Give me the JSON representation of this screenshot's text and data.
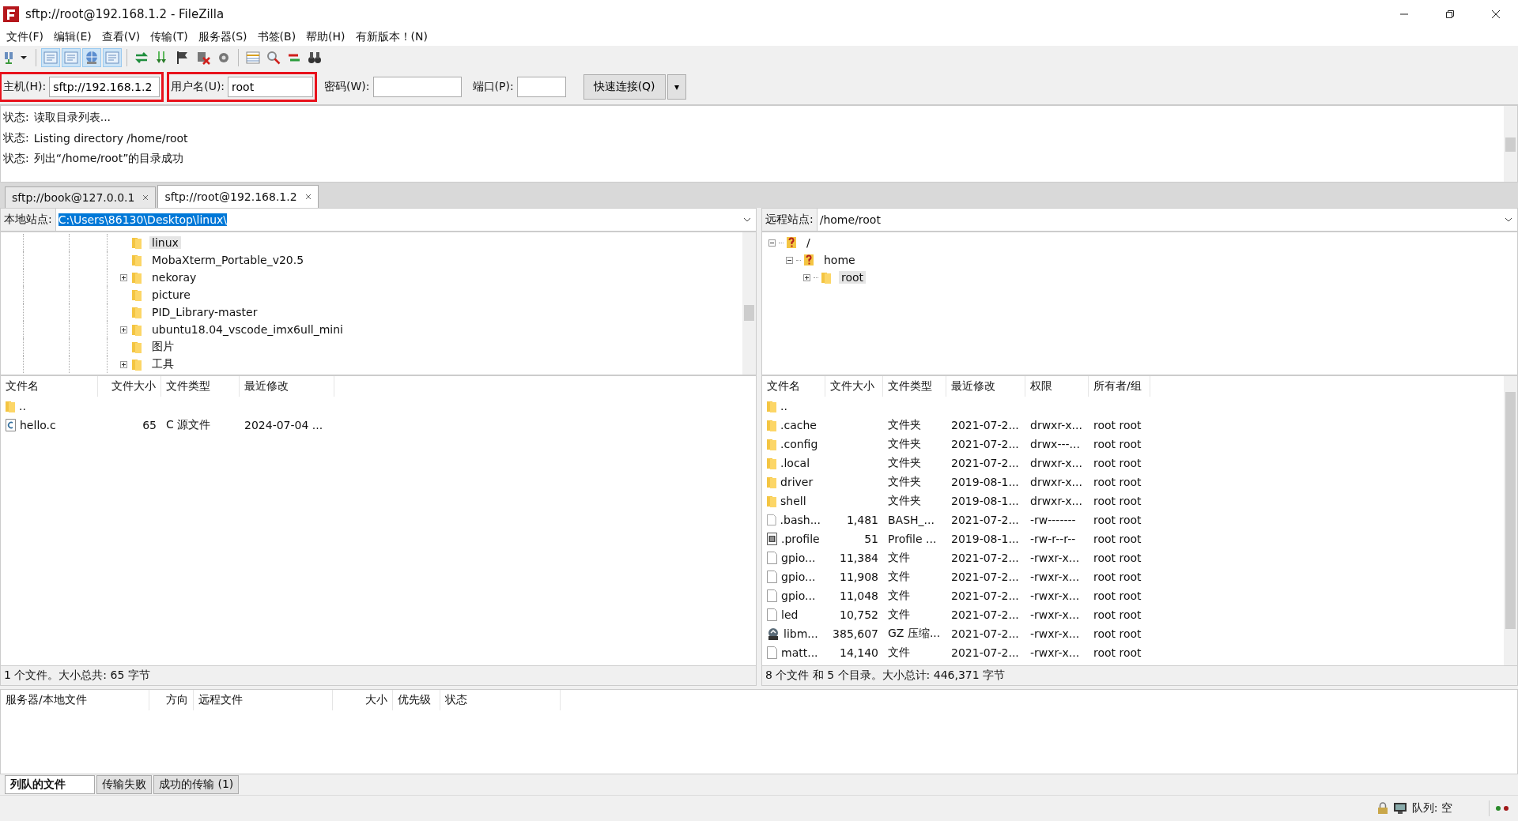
{
  "window": {
    "title": "sftp://root@192.168.1.2 - FileZilla"
  },
  "menu": [
    "文件(F)",
    "编辑(E)",
    "查看(V)",
    "传输(T)",
    "服务器(S)",
    "书签(B)",
    "帮助(H)",
    "有新版本！(N)"
  ],
  "quickconnect": {
    "fields": [
      {
        "label": "主机(H):",
        "value": "sftp://192.168.1.2",
        "highlighted": true
      },
      {
        "label": "用户名(U):",
        "value": "root",
        "highlighted": true
      },
      {
        "label": "密码(W):",
        "highlighted": false
      },
      {
        "label": "端口(P):",
        "highlighted": false
      }
    ],
    "connect_button": "快速连接(Q)",
    "dropdown": "▾"
  },
  "log": [
    {
      "prefix": "状态:",
      "text": "读取目录列表..."
    },
    {
      "prefix": "状态:",
      "text": "Listing directory /home/root"
    },
    {
      "prefix": "状态:",
      "text": "列出“/home/root”的目录成功"
    }
  ],
  "tabs": [
    {
      "label": "sftp://book@127.0.0.1",
      "selected": false
    },
    {
      "label": "sftp://root@192.168.1.2",
      "selected": true
    }
  ],
  "local": {
    "site_label": "本地站点:",
    "path": "C:\\Users\\86130\\Desktop\\linux\\",
    "tree": [
      {
        "name": "linux",
        "expandable": false,
        "selected": true
      },
      {
        "name": "MobaXterm_Portable_v20.5",
        "expandable": false,
        "selected": false
      },
      {
        "name": "nekoray",
        "expandable": true,
        "selected": false
      },
      {
        "name": "picture",
        "expandable": false,
        "selected": false
      },
      {
        "name": "PID_Library-master",
        "expandable": false,
        "selected": false
      },
      {
        "name": "ubuntu18.04_vscode_imx6ull_mini",
        "expandable": true,
        "selected": false
      },
      {
        "name": "图片",
        "expandable": false,
        "selected": false
      },
      {
        "name": "工具",
        "expandable": true,
        "selected": false
      }
    ],
    "columns": [
      "文件名",
      "文件大小",
      "文件类型",
      "最近修改"
    ],
    "rows": [
      {
        "kind": "folder",
        "cells": [
          "..",
          "",
          "",
          ""
        ]
      },
      {
        "kind": "c-source",
        "cells": [
          "hello.c",
          "65",
          "C 源文件",
          "2024-07-04 ..."
        ]
      }
    ],
    "status": "1 个文件。大小总共: 65 字节"
  },
  "remote": {
    "site_label": "远程站点:",
    "path": "/home/root",
    "tree": [
      {
        "name": "/",
        "kind": "unknown",
        "expanded": true,
        "selected": false,
        "children": [
          {
            "name": "home",
            "kind": "unknown",
            "expanded": true,
            "selected": false,
            "children": [
              {
                "name": "root",
                "kind": "folder",
                "expanded": false,
                "selected": true
              }
            ]
          }
        ]
      }
    ],
    "columns": [
      "文件名",
      "文件大小",
      "文件类型",
      "最近修改",
      "权限",
      "所有者/组"
    ],
    "rows": [
      {
        "kind": "folder",
        "cells": [
          "..",
          "",
          "",
          "",
          "",
          ""
        ]
      },
      {
        "kind": "folder",
        "cells": [
          ".cache",
          "",
          "文件夹",
          "2021-07-2...",
          "drwxr-x...",
          "root root"
        ]
      },
      {
        "kind": "folder",
        "cells": [
          ".config",
          "",
          "文件夹",
          "2021-07-2...",
          "drwx---...",
          "root root"
        ]
      },
      {
        "kind": "folder",
        "cells": [
          ".local",
          "",
          "文件夹",
          "2021-07-2...",
          "drwxr-x...",
          "root root"
        ]
      },
      {
        "kind": "folder",
        "cells": [
          "driver",
          "",
          "文件夹",
          "2019-08-1...",
          "drwxr-x...",
          "root root"
        ]
      },
      {
        "kind": "folder",
        "cells": [
          "shell",
          "",
          "文件夹",
          "2019-08-1...",
          "drwxr-x...",
          "root root"
        ]
      },
      {
        "kind": "file",
        "cells": [
          ".bash...",
          "1,481",
          "BASH_...",
          "2021-07-2...",
          "-rw-------",
          "root root"
        ]
      },
      {
        "kind": "script",
        "cells": [
          ".profile",
          "51",
          "Profile ...",
          "2019-08-1...",
          "-rw-r--r--",
          "root root"
        ]
      },
      {
        "kind": "file",
        "cells": [
          "gpio...",
          "11,384",
          "文件",
          "2021-07-2...",
          "-rwxr-x...",
          "root root"
        ]
      },
      {
        "kind": "file",
        "cells": [
          "gpio...",
          "11,908",
          "文件",
          "2021-07-2...",
          "-rwxr-x...",
          "root root"
        ]
      },
      {
        "kind": "file",
        "cells": [
          "gpio...",
          "11,048",
          "文件",
          "2021-07-2...",
          "-rwxr-x...",
          "root root"
        ]
      },
      {
        "kind": "file",
        "cells": [
          "led",
          "10,752",
          "文件",
          "2021-07-2...",
          "-rwxr-x...",
          "root root"
        ]
      },
      {
        "kind": "archive",
        "cells": [
          "libm...",
          "385,607",
          "GZ 压缩...",
          "2021-07-2...",
          "-rwxr-x...",
          "root root"
        ]
      },
      {
        "kind": "file",
        "cells": [
          "matt...",
          "14,140",
          "文件",
          "2021-07-2...",
          "-rwxr-x...",
          "root root"
        ]
      }
    ],
    "status": "8 个文件 和 5 个目录。大小总计: 446,371 字节"
  },
  "queue": {
    "columns": [
      "服务器/本地文件",
      "方向",
      "远程文件",
      "大小",
      "优先级",
      "状态"
    ],
    "tabs": [
      {
        "label": "列队的文件",
        "selected": true
      },
      {
        "label": "传输失败",
        "selected": false
      },
      {
        "label": "成功的传输 (1)",
        "selected": false
      }
    ],
    "status": "队列: 空"
  }
}
